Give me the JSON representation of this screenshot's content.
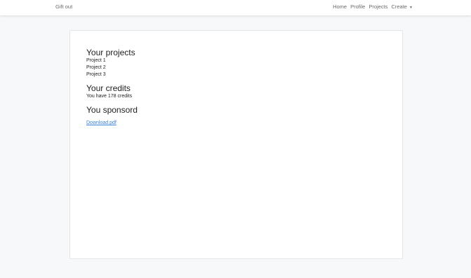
{
  "nav": {
    "brand": "Gift out",
    "links": [
      "Home",
      "Profile",
      "Projects"
    ],
    "create_label": "Create",
    "caret": "▼"
  },
  "main": {
    "projects": {
      "title": "Your projects",
      "items": [
        "Project 1",
        "Project 2",
        "Project 3"
      ]
    },
    "credits": {
      "title": "Your credits",
      "text": "You have 178 credits"
    },
    "sponsored": {
      "title": "You sponsord",
      "link": "Download.pdf"
    }
  },
  "colors": {
    "link": "#3b82d6",
    "background": "#f7f8fa"
  }
}
